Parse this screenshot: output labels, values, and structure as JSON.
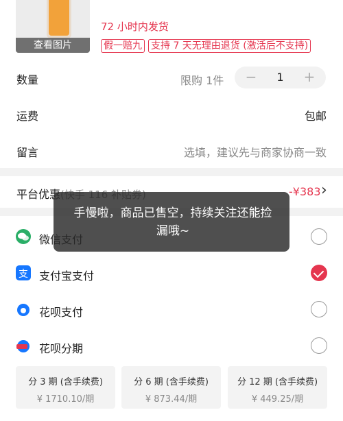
{
  "product": {
    "view_image": "查看图片",
    "shipping": "72 小时内发货",
    "tags": [
      "假一赔九",
      "支持 7 天无理由退货 (激活后不支持)"
    ]
  },
  "quantity": {
    "label": "数量",
    "limit": "限购 1件",
    "minus": "−",
    "value": "1",
    "plus": "+"
  },
  "freight": {
    "label": "运费",
    "value": "包邮"
  },
  "message": {
    "label": "留言",
    "placeholder": "选填，建议先与商家协商一致"
  },
  "discount": {
    "label": "平台优惠",
    "note": "(快手 116 补贴券)",
    "amount": "-¥383",
    "chevron": "›"
  },
  "payment": {
    "methods": [
      {
        "label": "微信支付",
        "icon": "wechat-icon",
        "color": "#2aae67",
        "selected": false
      },
      {
        "label": "支付宝支付",
        "icon": "alipay-icon",
        "color": "#1677ff",
        "selected": true
      },
      {
        "label": "花呗支付",
        "icon": "huabei-icon",
        "color": "#1677ff",
        "selected": false
      },
      {
        "label": "花呗分期",
        "icon": "huabei-installment-icon",
        "color": "#1677ff",
        "selected": false
      }
    ],
    "plans": [
      {
        "term": "分 3 期 (含手续费)",
        "price": "¥ 1710.10/期"
      },
      {
        "term": "分 6 期 (含手续费)",
        "price": "¥ 873.44/期"
      },
      {
        "term": "分 12 期 (含手续费)",
        "price": "¥ 449.25/期"
      }
    ]
  },
  "toast": {
    "message": "手慢啦，商品已售空，持续关注还能捡漏哦~"
  },
  "colors": {
    "accent": "#e5364f",
    "wechat": "#2aae67",
    "alipay": "#1677ff"
  }
}
